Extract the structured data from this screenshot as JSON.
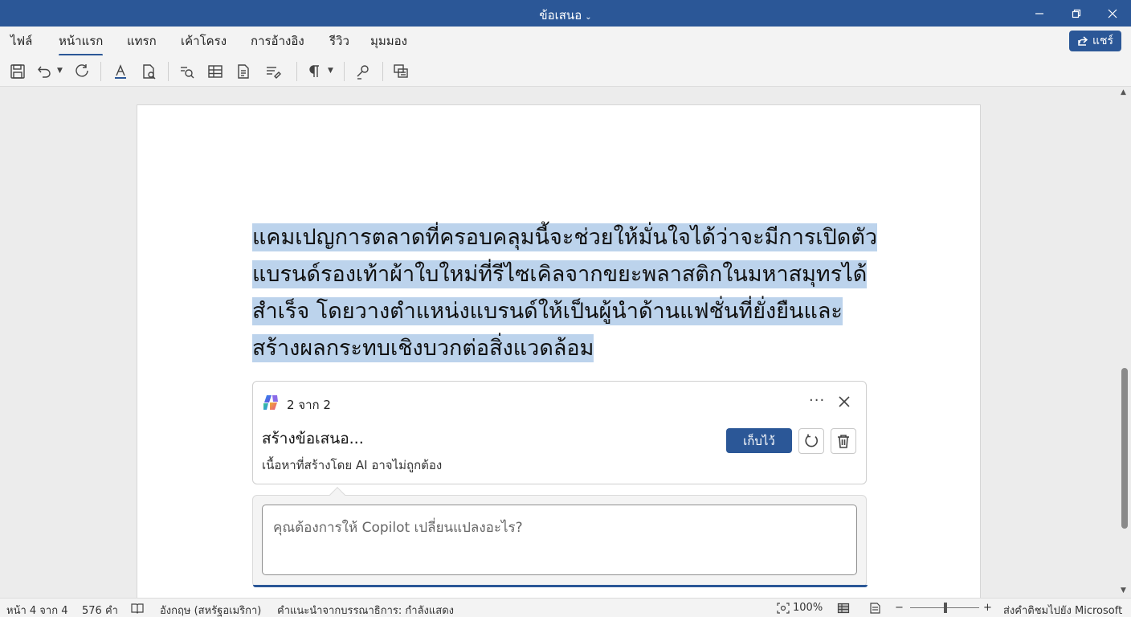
{
  "window": {
    "title": "ข้อเสนอ",
    "title_chevron": "⌄"
  },
  "ribbon": {
    "tabs": [
      {
        "label": "ไฟล์"
      },
      {
        "label": "หน้าแรก",
        "active": true
      },
      {
        "label": "แทรก"
      },
      {
        "label": "เค้าโครง"
      },
      {
        "label": "การอ้างอิง"
      },
      {
        "label": "รีวิว"
      },
      {
        "label": "มุมมอง"
      }
    ],
    "share_label": "แชร์"
  },
  "toolbar": {
    "icons": [
      "save-icon",
      "undo-icon",
      "redo-icon",
      "font-color-icon",
      "document-check-icon",
      "find-icon",
      "table-icon",
      "document-icon",
      "format-icon",
      "paragraph-mark-icon",
      "pen-icon",
      "copilot-pane-icon"
    ]
  },
  "document": {
    "paragraph": "แคมเปญการตลาดที่ครอบคลุมนี้จะช่วยให้มั่นใจได้ว่าจะมีการเปิดตัวแบรนด์รองเท้าผ้าใบใหม่ที่รีไซเคิลจากขยะพลาสติกในมหาสมุทรได้สำเร็จ โดยวางตำแหน่งแบรนด์ให้เป็นผู้นำด้านแฟชั่นที่ยั่งยืนและสร้างผลกระทบเชิงบวกต่อสิ่งแวดล้อม",
    "highlight_color": "#bcd3ec"
  },
  "copilot": {
    "counter": "2 จาก 2",
    "more": "···",
    "heading": "สร้างข้อเสนอ...",
    "disclaimer": "เนื้อหาที่สร้างโดย AI อาจไม่ถูกต้อง",
    "keep_label": "เก็บไว้",
    "prompt_placeholder": "คุณต้องการให้ Copilot เปลี่ยนแปลงอะไร?"
  },
  "statusbar": {
    "page": "หน้า 4 จาก 4",
    "words": "576 คำ",
    "language": "อังกฤษ (สหรัฐอเมริกา)",
    "editor_suggestions": "คำแนะนำจากบรรณาธิการ: กำลังแสดง",
    "zoom": "100%",
    "zoom_minus": "−",
    "zoom_plus": "+",
    "feedback": "ส่งคำติชมไปยัง Microsoft"
  },
  "colors": {
    "accent": "#2b5797",
    "selection": "#bcd3ec"
  }
}
